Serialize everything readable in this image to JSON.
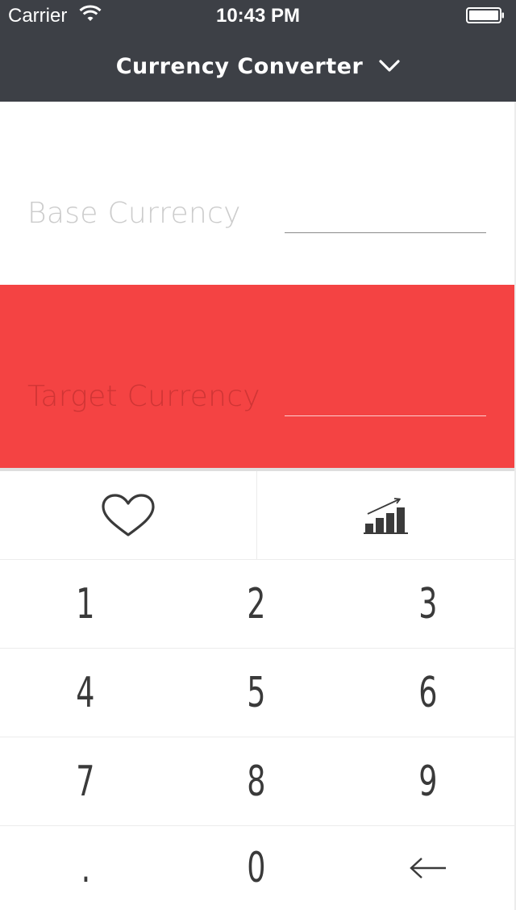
{
  "status_bar": {
    "carrier": "Carrier",
    "time": "10:43 PM",
    "wifi_icon": "wifi-icon",
    "battery_icon": "battery-icon"
  },
  "nav": {
    "title": "Currency Converter",
    "dropdown_icon": "chevron-down-icon"
  },
  "base": {
    "label": "Base Currency",
    "value": ""
  },
  "target": {
    "label": "Target Currency",
    "value": ""
  },
  "actions": {
    "favorite_icon": "heart-icon",
    "chart_icon": "chart-trend-icon"
  },
  "keypad": {
    "keys": [
      "1",
      "2",
      "3",
      "4",
      "5",
      "6",
      "7",
      "8",
      "9",
      ".",
      "0"
    ],
    "backspace_icon": "back-arrow-icon"
  },
  "colors": {
    "header_bg": "#3d4046",
    "target_bg": "#f44343",
    "key_text": "#3a3a3a"
  }
}
